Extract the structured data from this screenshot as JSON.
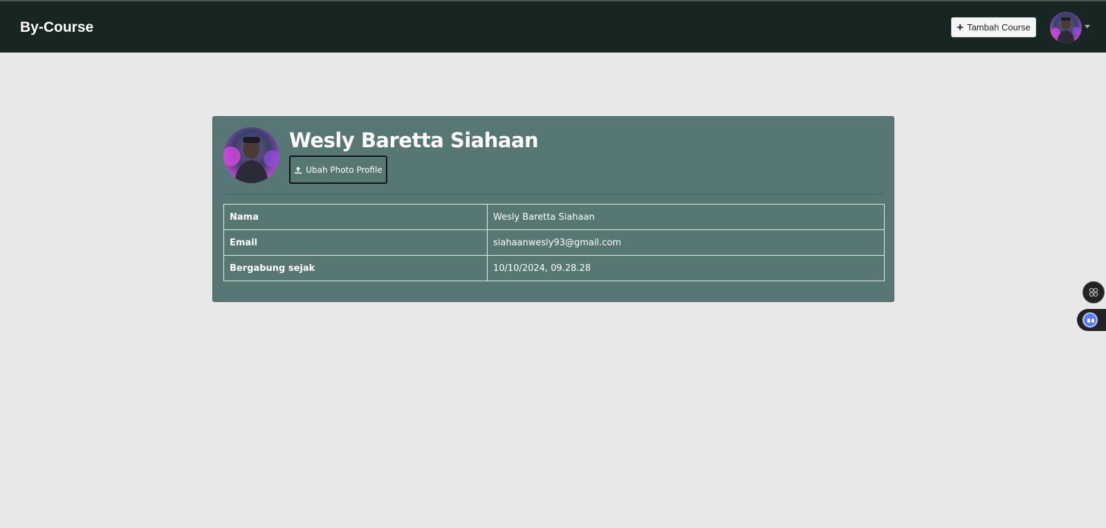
{
  "navbar": {
    "brand": "By-Course",
    "add_course_label": "Tambah Course"
  },
  "profile": {
    "name": "Wesly Baretta Siahaan",
    "upload_label": "Ubah Photo Profile"
  },
  "info_table": {
    "rows": [
      {
        "label": "Nama",
        "value": "Wesly Baretta Siahaan"
      },
      {
        "label": "Email",
        "value": "siahaanwesly93@gmail.com"
      },
      {
        "label": "Bergabung sejak",
        "value": "10/10/2024, 09.28.28"
      }
    ]
  },
  "icons": {
    "add": "plus-icon",
    "upload": "upload-icon",
    "dropdown": "chevron-down-icon",
    "widget": "command-icon",
    "assistant": "bot-icon"
  },
  "colors": {
    "navbar_bg": "#172523",
    "page_bg": "#e8e8e8",
    "card_bg": "#577774"
  }
}
